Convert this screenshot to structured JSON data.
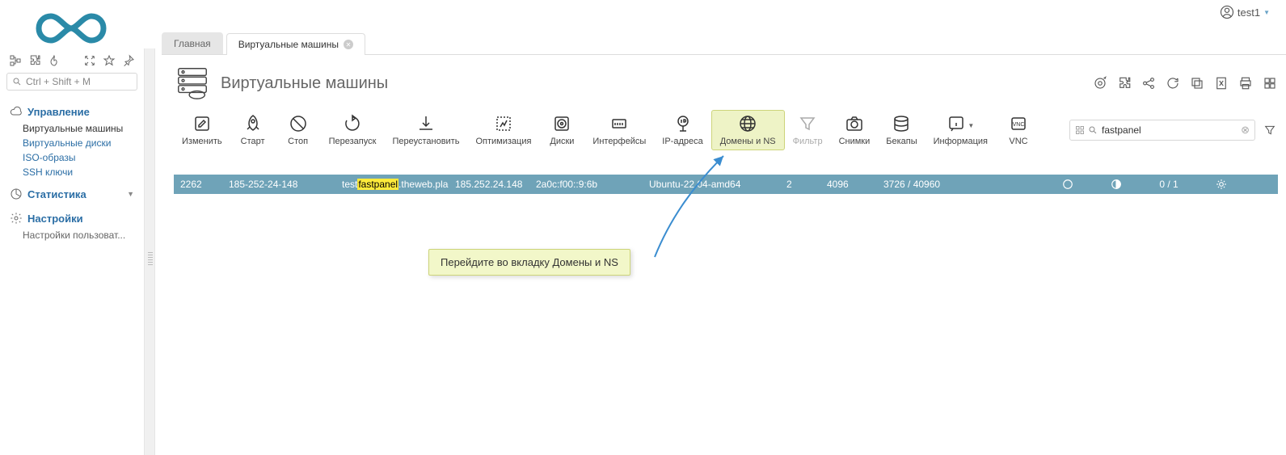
{
  "user": {
    "name": "test1"
  },
  "sidebar": {
    "search_placeholder": "Ctrl + Shift + M",
    "sections": [
      {
        "title": "Управление",
        "items": [
          "Виртуальные машины",
          "Виртуальные диски",
          "ISO-образы",
          "SSH ключи"
        ]
      },
      {
        "title": "Статистика",
        "items": []
      },
      {
        "title": "Настройки",
        "items": [
          "Настройки пользоват..."
        ]
      }
    ]
  },
  "tabs": [
    "Главная",
    "Виртуальные машины"
  ],
  "page": {
    "title": "Виртуальные машины"
  },
  "toolbar": {
    "items": [
      {
        "label": "Изменить",
        "key": "edit"
      },
      {
        "label": "Старт",
        "key": "start"
      },
      {
        "label": "Стоп",
        "key": "stop"
      },
      {
        "label": "Перезапуск",
        "key": "restart"
      },
      {
        "label": "Переустановить",
        "key": "reinstall"
      },
      {
        "label": "Оптимизация",
        "key": "optimize"
      },
      {
        "label": "Диски",
        "key": "disks"
      },
      {
        "label": "Интерфейсы",
        "key": "interfaces"
      },
      {
        "label": "IP-адреса",
        "key": "ip"
      },
      {
        "label": "Домены и NS",
        "key": "domains"
      },
      {
        "label": "Фильтр",
        "key": "filter"
      },
      {
        "label": "Снимки",
        "key": "snapshots"
      },
      {
        "label": "Бекапы",
        "key": "backups"
      },
      {
        "label": "Информация",
        "key": "info"
      },
      {
        "label": "VNC",
        "key": "vnc"
      }
    ],
    "search_value": "fastpanel"
  },
  "row": {
    "id": "2262",
    "name_pre": "test",
    "name_hl": "fastpanel",
    "name_post": ".theweb.place",
    "ipv4": "185.252.24.148",
    "hostname": "185-252-24-148",
    "ipv6": "2a0c:f00::9:6b",
    "os": "Ubuntu-22.04-amd64",
    "cpu": "2",
    "ram": "4096",
    "disk": "3726 / 40960",
    "count": "0 / 1"
  },
  "callout": {
    "text": "Перейдите во вкладку Домены и NS"
  }
}
